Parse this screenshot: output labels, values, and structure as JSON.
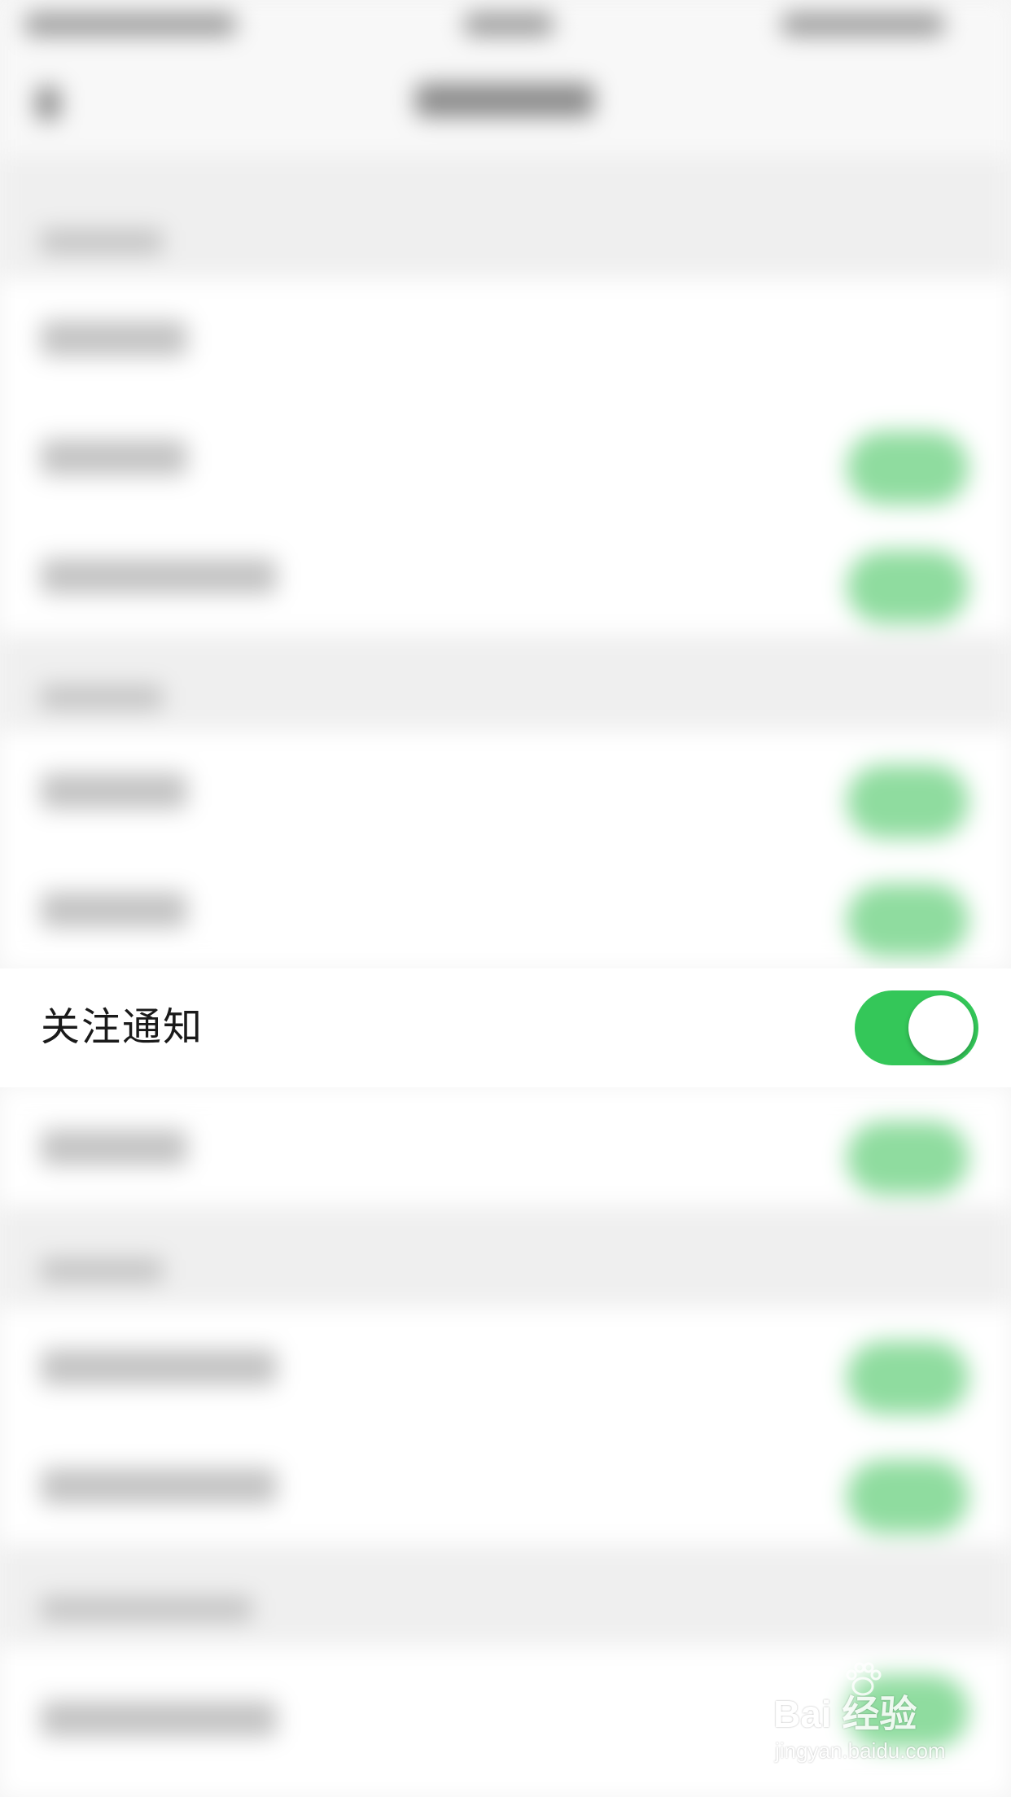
{
  "focused_setting": {
    "label": "关注通知",
    "toggle_on": true,
    "toggle_color": "#34c759"
  },
  "watermark": {
    "brand": "Bai  经验",
    "url": "jingyan.baidu.com"
  }
}
